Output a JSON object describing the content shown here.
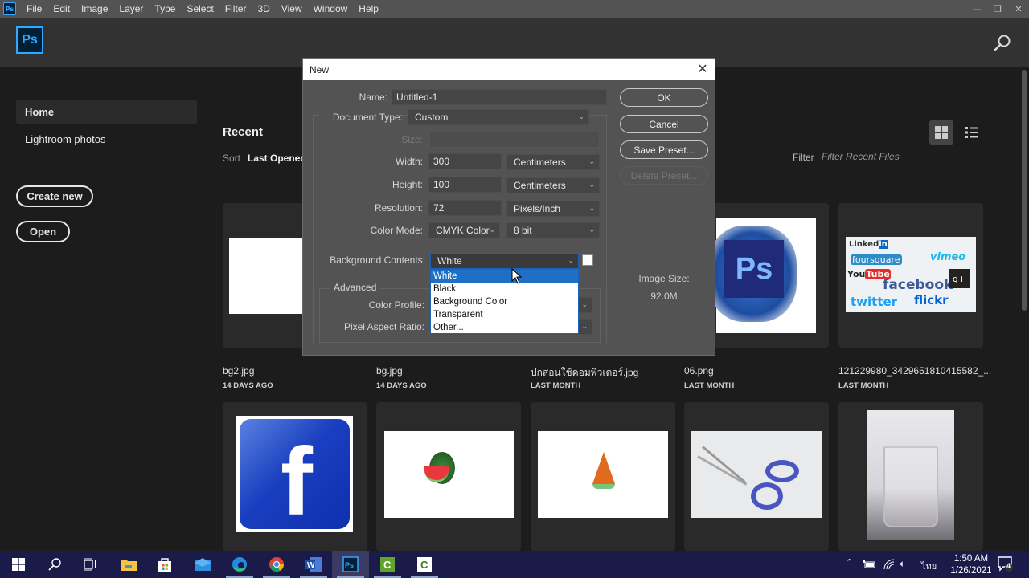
{
  "menubar": {
    "items": [
      "File",
      "Edit",
      "Image",
      "Layer",
      "Type",
      "Select",
      "Filter",
      "3D",
      "View",
      "Window",
      "Help"
    ],
    "app_icon": "Ps",
    "window_controls": {
      "minimize": "—",
      "restore": "❐",
      "close": "✕"
    }
  },
  "home": {
    "logo": "Ps",
    "sidebar": [
      {
        "label": "Home",
        "active": true
      },
      {
        "label": "Lightroom photos",
        "active": false
      }
    ],
    "create_new": "Create new",
    "open": "Open",
    "recent_title": "Recent",
    "sort_label": "Sort",
    "sort_value": "Last Opened",
    "filter_label": "Filter",
    "filter_placeholder": "Filter Recent Files",
    "files": [
      {
        "name": "bg2.jpg",
        "date": "14 DAYS AGO"
      },
      {
        "name": "bg.jpg",
        "date": "14 DAYS AGO"
      },
      {
        "name": "ปกสอนใช้คอมพิวเตอร์.jpg",
        "date": "LAST MONTH"
      },
      {
        "name": "06.png",
        "date": "LAST MONTH"
      },
      {
        "name": "121229980_3429651810415582_...",
        "date": "LAST MONTH"
      }
    ],
    "second_row_thumbs": [
      "facebook-logo",
      "watermelon",
      "watermelon-slice",
      "scissors",
      "glass"
    ]
  },
  "dialog": {
    "title": "New",
    "name_label": "Name:",
    "name_value": "Untitled-1",
    "doc_type_label": "Document Type:",
    "doc_type_value": "Custom",
    "size_label": "Size:",
    "size_value": "",
    "width_label": "Width:",
    "width_value": "300",
    "width_unit": "Centimeters",
    "height_label": "Height:",
    "height_value": "100",
    "height_unit": "Centimeters",
    "resolution_label": "Resolution:",
    "resolution_value": "72",
    "resolution_unit": "Pixels/Inch",
    "color_mode_label": "Color Mode:",
    "color_mode_value": "CMYK Color",
    "bit_depth": "8 bit",
    "bg_contents_label": "Background Contents:",
    "bg_contents_value": "White",
    "bg_options": [
      "White",
      "Black",
      "Background Color",
      "Transparent",
      "Other..."
    ],
    "bg_selected_index": 0,
    "advanced_label": "Advanced",
    "color_profile_label": "Color Profile:",
    "pixel_aspect_label": "Pixel Aspect Ratio:",
    "image_size_label": "Image Size:",
    "image_size_value": "92.0M",
    "buttons": {
      "ok": "OK",
      "cancel": "Cancel",
      "save_preset": "Save Preset...",
      "delete_preset": "Delete Preset..."
    }
  },
  "taskbar": {
    "apps": [
      "start",
      "search",
      "task-view",
      "file-explorer",
      "store",
      "mail",
      "edge",
      "chrome",
      "word",
      "photoshop",
      "camtasia",
      "camtasia-recorder"
    ],
    "active_app": "photoshop",
    "language": "ไทย",
    "time": "1:50 AM",
    "date": "1/26/2021",
    "notifications": "4"
  },
  "colors": {
    "ps_blue": "#31a8ff",
    "ps_dark": "#001e36",
    "selection_blue": "#1e6fc6",
    "dialog_bg": "#535353"
  }
}
